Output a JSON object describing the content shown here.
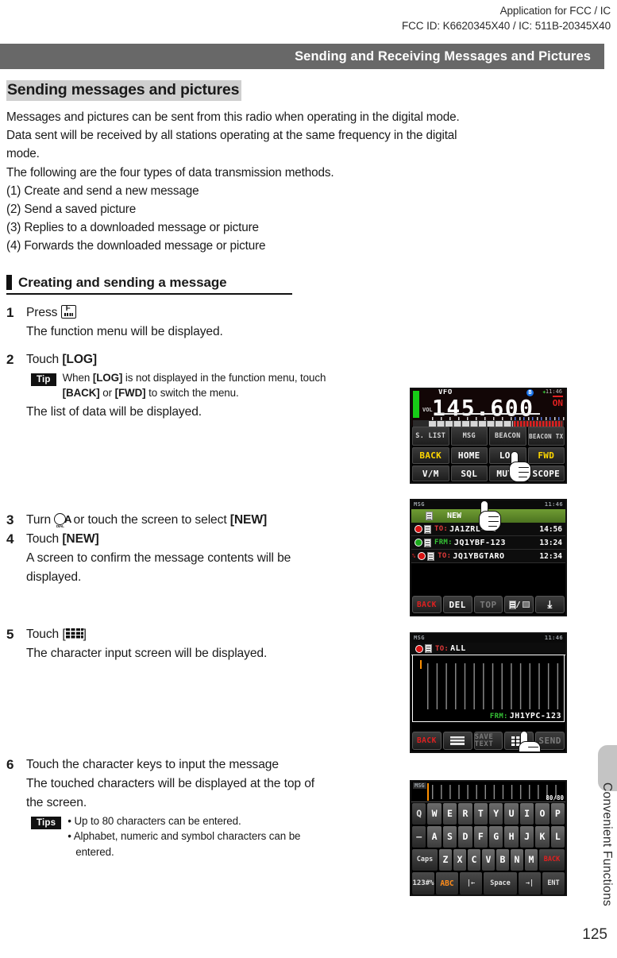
{
  "fcc_header": {
    "line1": "Application for FCC /  IC",
    "line2": "FCC ID: K6620345X40 /  IC: 511B-20345X40"
  },
  "chapter_bar": {
    "title": "Sending and Receiving Messages and Pictures"
  },
  "section": {
    "title": "Sending messages and pictures",
    "paragraphs": [
      "Messages and pictures can be sent from this radio when operating in the digital mode.",
      "Data sent will be received by all stations operating at the same frequency in the digital",
      "mode.",
      "The following are the four types of data transmission methods.",
      "(1) Create and send a new message",
      "(2) Send a saved picture",
      "(3) Replies to a downloaded message or picture",
      "(4) Forwards the downloaded message or picture"
    ]
  },
  "subsection": {
    "title": "Creating and sending a message"
  },
  "steps": {
    "s1": {
      "num": "1",
      "action_prefix": "Press ",
      "icon": "f-key-icon",
      "result": "The function menu will be displayed."
    },
    "s2": {
      "num": "2",
      "action_prefix": "Touch ",
      "action_target": "[LOG]",
      "tip_tag": "Tip",
      "tip_line1_a": "When ",
      "tip_line1_b": "[LOG]",
      "tip_line1_c": " is not displayed in the function menu, touch",
      "tip_line2_a": "[BACK]",
      "tip_line2_b": " or ",
      "tip_line2_c": "[FWD]",
      "tip_line2_d": " to switch the menu.",
      "result": "The list of data will be displayed."
    },
    "s3": {
      "num": "3",
      "action_a": "Turn ",
      "icon": "dial-knob-icon",
      "action_b": " or touch the screen to select ",
      "action_target": "[NEW]"
    },
    "s4": {
      "num": "4",
      "action_prefix": "Touch ",
      "action_target": "[NEW]",
      "result_line1": "A screen to confirm the message contents will be",
      "result_line2": "displayed."
    },
    "s5": {
      "num": "5",
      "action_prefix": "Touch [",
      "icon": "keyboard-icon",
      "action_suffix": "]",
      "result": "The character input screen will be displayed."
    },
    "s6": {
      "num": "6",
      "action": "Touch the character keys to input the message",
      "result_line1": "The touched characters will be displayed at the top of",
      "result_line2": "the screen.",
      "tips_tag": "Tips",
      "tip1": "• Up to 80 characters can be entered.",
      "tip2": "• Alphabet, numeric and  symbol characters can be",
      "tip2b": "entered."
    }
  },
  "screens": {
    "vfo": {
      "status_left": "VFO",
      "status_time": "11:46",
      "frequency": "145.600",
      "vol_label": "VOL",
      "on_indicator": "ON",
      "bt_icon": "bluetooth-icon",
      "gps_icon": "gps-icon",
      "row1": [
        "S. LIST",
        "MSG",
        "BEACON",
        "BEACON TX"
      ],
      "row2_back": "BACK",
      "row2_back_arrow": "←",
      "row2_home": "HOME",
      "row2_log": "LOG",
      "row2_fwd": "FWD",
      "row2_fwd_arrow": "→",
      "row3": [
        "V/M",
        "SQL",
        "MUTE",
        "SCOPE"
      ]
    },
    "msglist": {
      "status_left": "MSG",
      "status_time": "11:46",
      "selected": "NEW",
      "rows": [
        {
          "dir": "TO:",
          "dir_color": "red",
          "dot": "red",
          "call": "JA1ZRL-01",
          "time": "14:56",
          "prefix": ""
        },
        {
          "dir": "FRM:",
          "dir_color": "green",
          "dot": "green",
          "call": "JQ1YBF-123",
          "time": "13:24",
          "prefix": ""
        },
        {
          "dir": "TO:",
          "dir_color": "red",
          "dot": "red",
          "call": "JQ1YBGTARO",
          "time": "12:34",
          "prefix": "%"
        }
      ],
      "buttons": [
        "BACK",
        "DEL",
        "TOP",
        "DOC/PIC",
        "DOWN"
      ]
    },
    "compose": {
      "status_left": "MSG",
      "status_time": "11:46",
      "to_label": "TO:",
      "to_value": "ALL",
      "frm_label": "FRM:",
      "frm_value": "JH1YPC-123",
      "buttons": [
        "BACK",
        "LIST",
        "SAVE TEXT",
        "KEYBOARD",
        "SEND"
      ]
    },
    "keyboard": {
      "status_left": "MSG",
      "char_count": "80/80",
      "row1": [
        "Q",
        "W",
        "E",
        "R",
        "T",
        "Y",
        "U",
        "I",
        "O",
        "P"
      ],
      "row2": [
        "—",
        "A",
        "S",
        "D",
        "F",
        "G",
        "H",
        "J",
        "K",
        "L"
      ],
      "row3": [
        "Caps",
        "Z",
        "X",
        "C",
        "V",
        "B",
        "N",
        "M",
        "BACK"
      ],
      "row4": [
        "123#%",
        "ABC",
        "|←",
        "Space",
        "→|",
        "ENT"
      ]
    }
  },
  "side_tab": {
    "label": "Convenient Functions"
  },
  "page_number": "125"
}
